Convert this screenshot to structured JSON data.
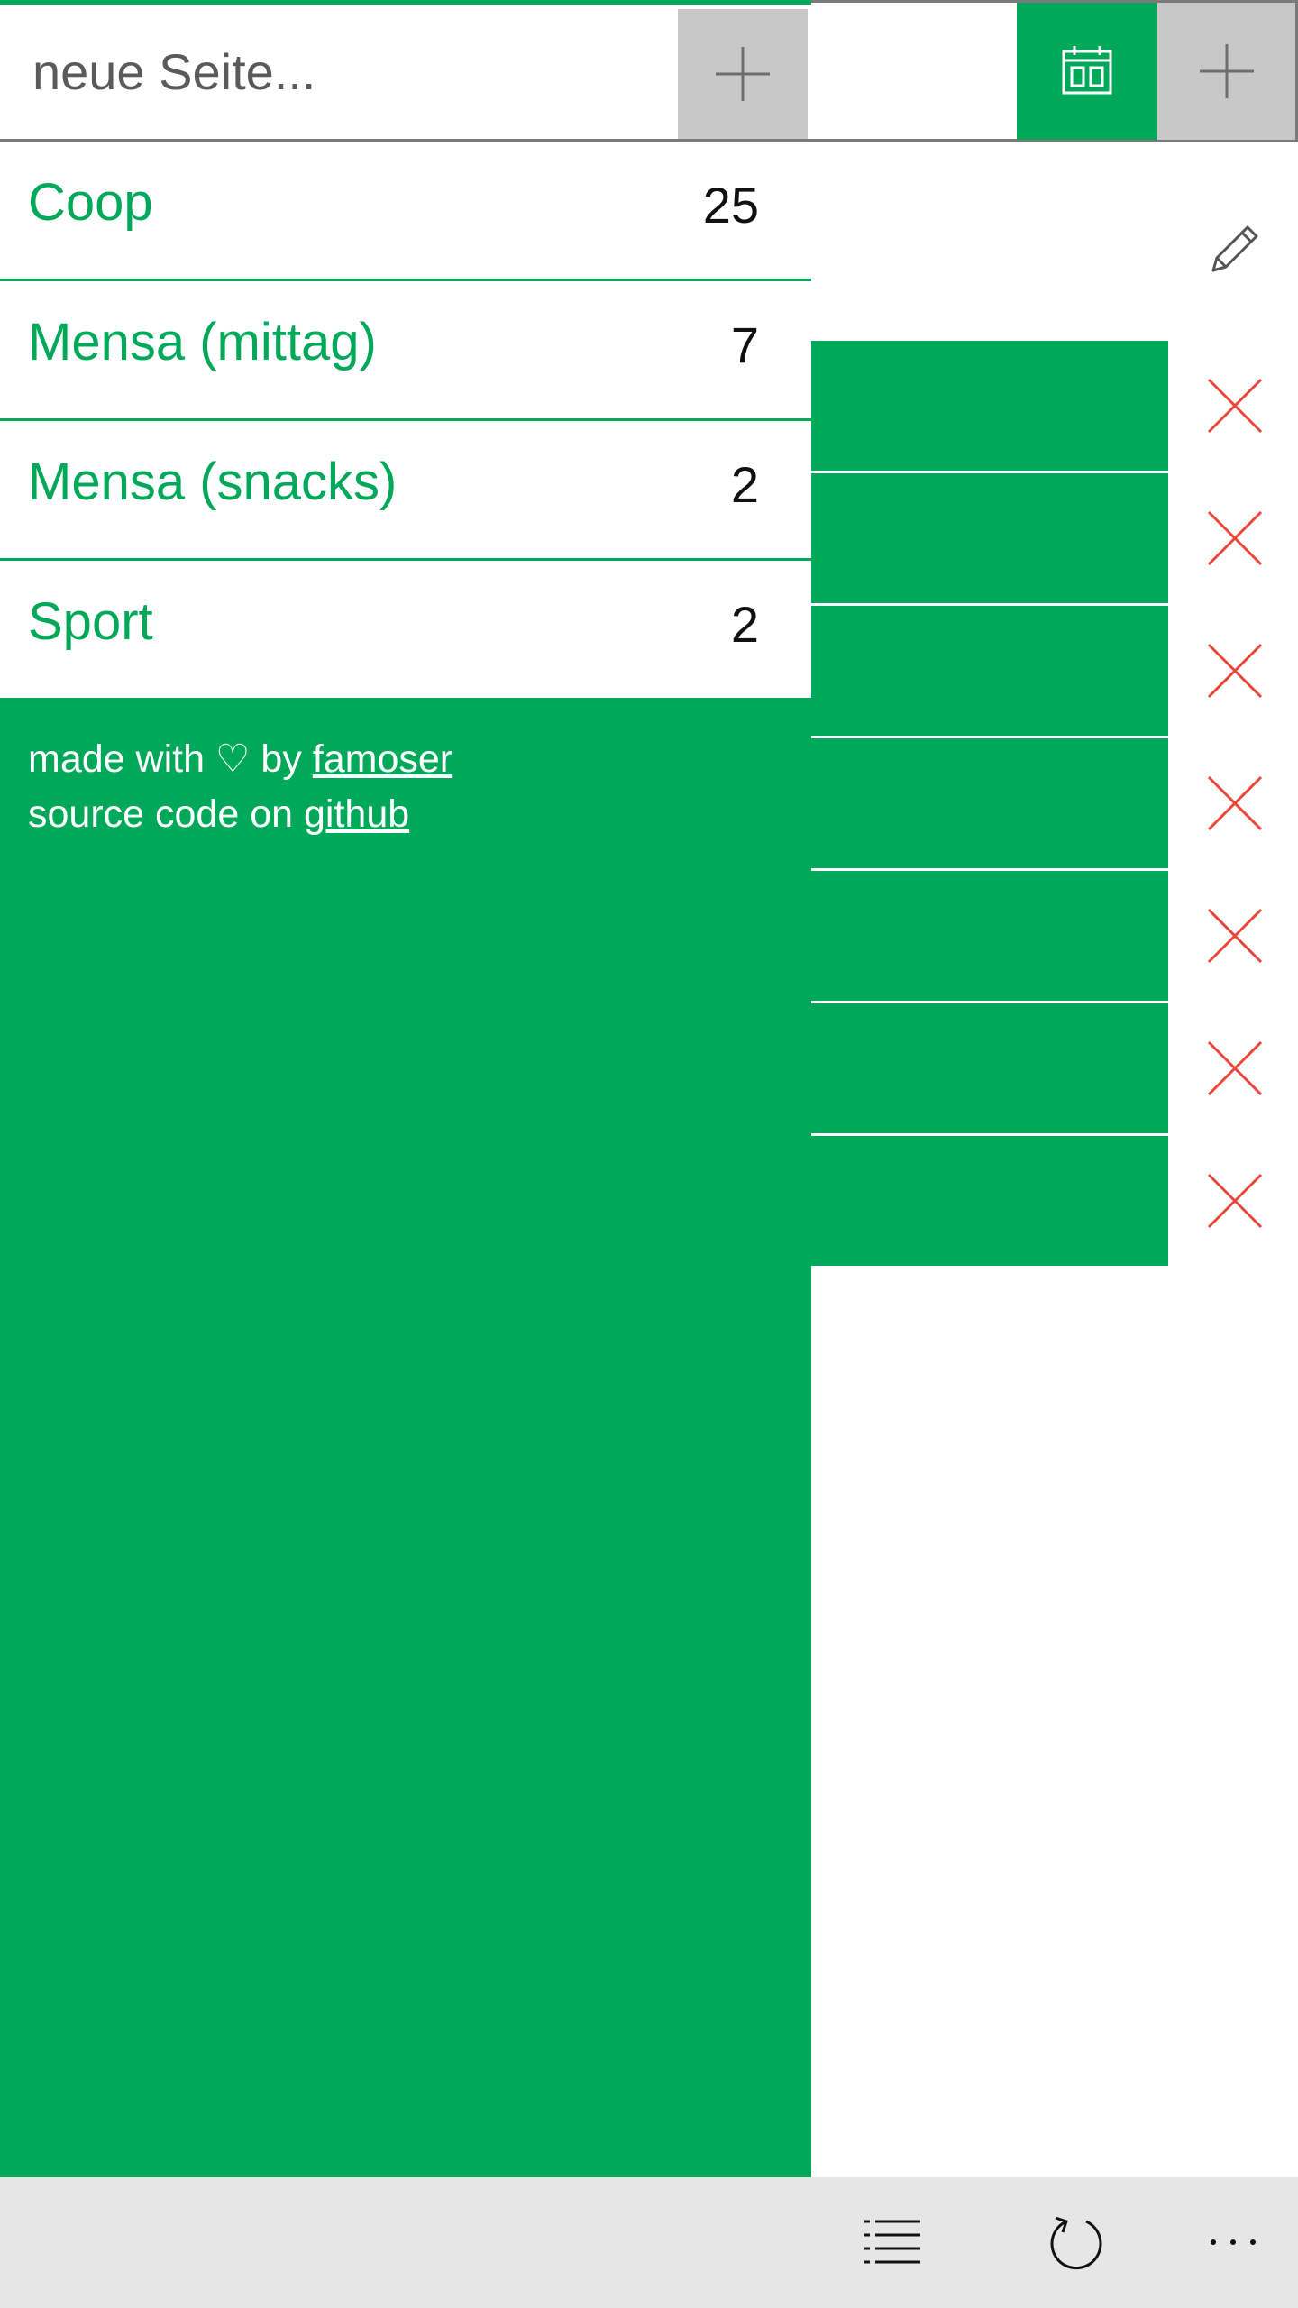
{
  "colors": {
    "accent": "#00a85a",
    "delete": "#e8473b",
    "appbar": "#e6e6e6",
    "button_gray": "#c8c8c8"
  },
  "header": {
    "calendar_icon": "calendar-icon",
    "add_icon": "plus-icon"
  },
  "pane": {
    "new_page_placeholder": "neue Seite...",
    "new_page_add_icon": "plus-icon",
    "pages": [
      {
        "name": "Coop",
        "count": "25"
      },
      {
        "name": "Mensa (mittag)",
        "count": "7"
      },
      {
        "name": "Mensa (snacks)",
        "count": "2"
      },
      {
        "name": "Sport",
        "count": "2"
      }
    ],
    "footer": {
      "made_with": "made with ♡ by",
      "author_link": "famoser",
      "source_text": "source code on",
      "source_link": "github"
    }
  },
  "main": {
    "edit_icon": "pencil-icon",
    "entries_count": 7,
    "delete_icon": "close-icon"
  },
  "appbar": {
    "icons": [
      "list-icon",
      "refresh-icon",
      "more-icon"
    ]
  }
}
